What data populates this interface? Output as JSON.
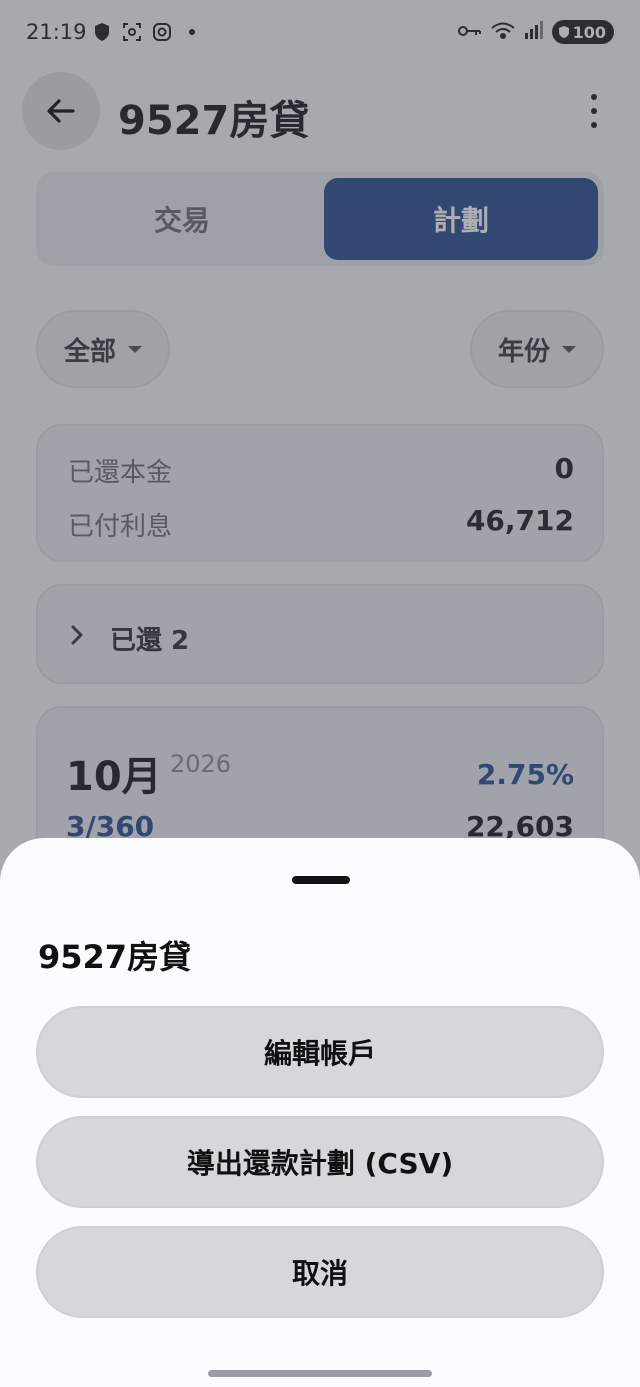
{
  "status_bar": {
    "time": "21:19",
    "battery": "100",
    "icons": [
      "shield-icon",
      "face-scan-icon",
      "instagram-icon",
      "dot-icon",
      "key-icon",
      "wifi-icon",
      "signal-icon",
      "battery-icon"
    ]
  },
  "header": {
    "title": "9527房貸"
  },
  "tabs": [
    {
      "label": "交易",
      "selected": false
    },
    {
      "label": "計劃",
      "selected": true
    }
  ],
  "filters": {
    "scope": "全部",
    "period": "年份"
  },
  "summary": {
    "principal_label": "已還本金",
    "principal_value": "0",
    "interest_label": "已付利息",
    "interest_value": "46,712"
  },
  "paid_section": {
    "label": "已還 2"
  },
  "schedule_item": {
    "month": "10月",
    "year": "2026",
    "rate": "2.75%",
    "term": "3/360",
    "amount": "22,603"
  },
  "sheet": {
    "title": "9527房貸",
    "buttons": {
      "edit": "編輯帳戶",
      "export": "導出還款計劃 (CSV)",
      "cancel": "取消"
    }
  },
  "colors": {
    "accent": "#2d4f95",
    "background": "#f4f6fa",
    "sheet_button": "#d7d7da"
  }
}
